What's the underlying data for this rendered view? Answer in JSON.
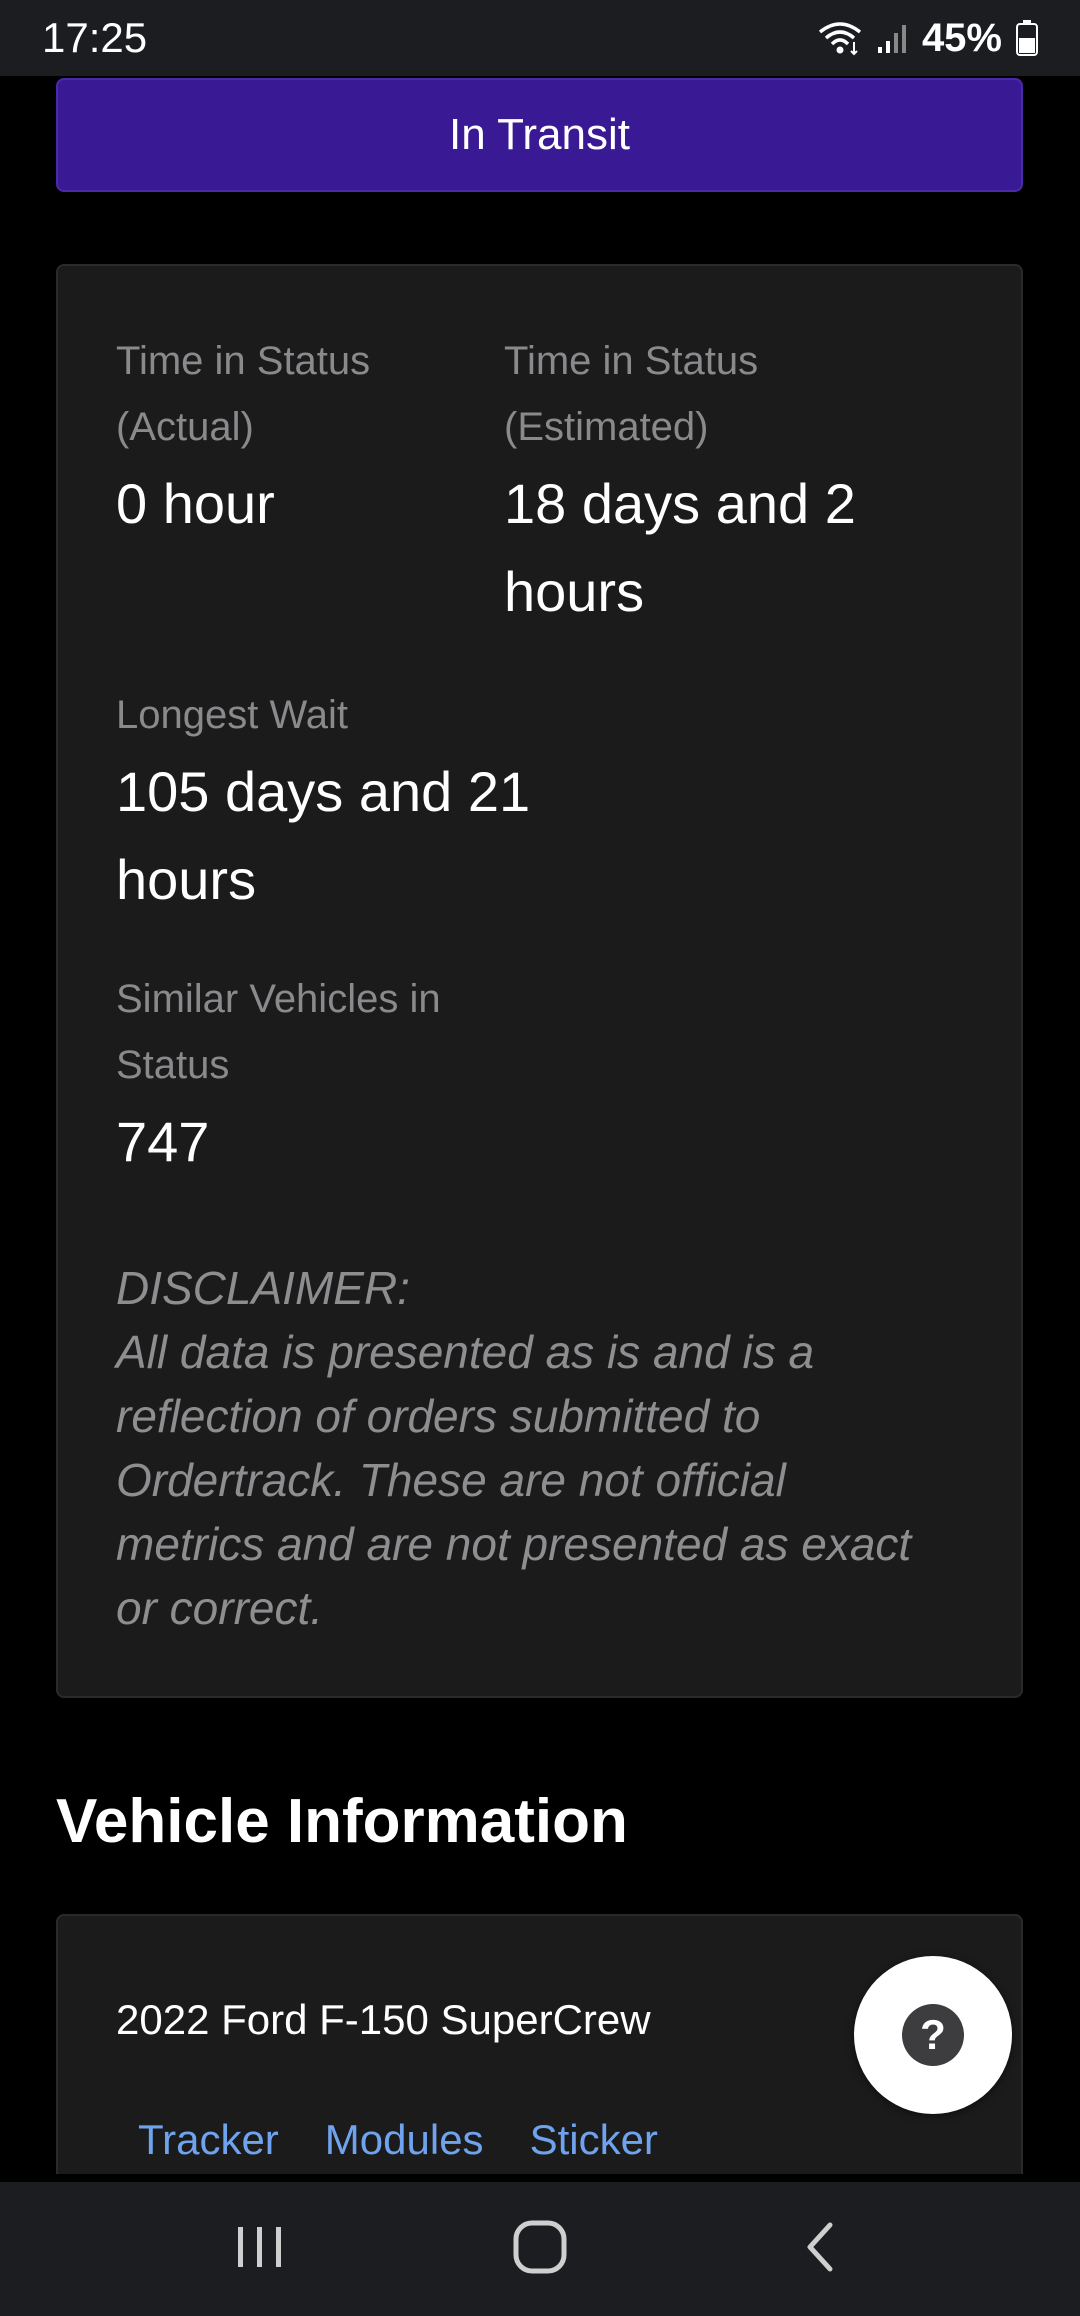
{
  "status_bar": {
    "time": "17:25",
    "battery": "45%",
    "icons": [
      "wifi-icon",
      "signal-icon",
      "battery-icon"
    ]
  },
  "status_button": {
    "label": "In Transit",
    "color": "#3a1a94"
  },
  "stats": {
    "actual_label": "Time in Status (Actual)",
    "actual_value": "0 hour",
    "estimated_label": "Time in Status (Estimated)",
    "estimated_value": "18 days and 2 hours",
    "longest_label": "Longest Wait",
    "longest_value": "105 days and 21 hours",
    "similar_label": "Similar Vehicles in Status",
    "similar_value": "747",
    "disclaimer_title": "DISCLAIMER:",
    "disclaimer_text": "All data is presented as is and is a reflection of orders submitted to Ordertrack. These are not official metrics and are not presented as exact or correct."
  },
  "vehicle_info": {
    "title": "Vehicle Information",
    "vehicle_name": "2022 Ford F-150 SuperCrew",
    "links": [
      "Tracker",
      "Modules",
      "Sticker"
    ],
    "link_color": "#6fa3ee"
  },
  "help": {
    "icon_glyph": "?"
  },
  "nav_bar": {
    "icons": [
      "recent-apps-icon",
      "home-icon",
      "back-icon"
    ]
  }
}
